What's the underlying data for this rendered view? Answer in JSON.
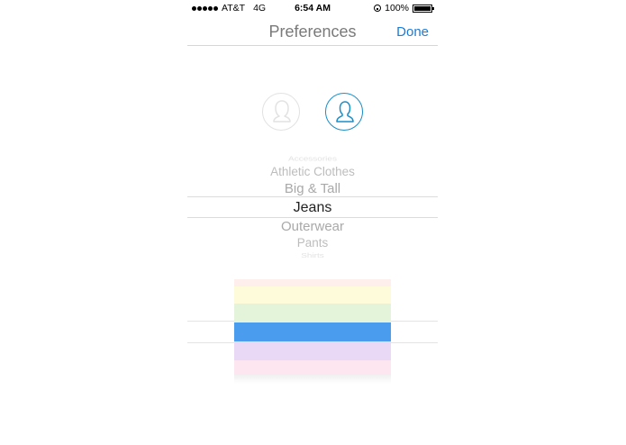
{
  "status_bar": {
    "carrier": "AT&T",
    "network": "4G",
    "time": "6:54 AM",
    "battery": "100%",
    "icons": [
      "signal-dots-icon",
      "rotation-lock-icon",
      "battery-icon"
    ]
  },
  "nav": {
    "title": "Preferences",
    "done_label": "Done"
  },
  "gender": {
    "options": [
      "female-profile-icon",
      "male-profile-icon"
    ],
    "selected_color": "#1b8ec8",
    "unselected_color": "#e2e2e2"
  },
  "category_picker": {
    "items": [
      "Accessories",
      "Athletic Clothes",
      "Big & Tall",
      "Jeans",
      "Outerwear",
      "Pants",
      "Shirts"
    ],
    "selected": "Jeans"
  },
  "color_picker": {
    "colors": [
      "#fde8e4",
      "#fdfbd9",
      "#e4f4da",
      "#4a9cee",
      "#e9d9f6",
      "#fde6ef"
    ],
    "selected_color": "#4a9cee"
  },
  "accent_color": "#1b7bd8"
}
